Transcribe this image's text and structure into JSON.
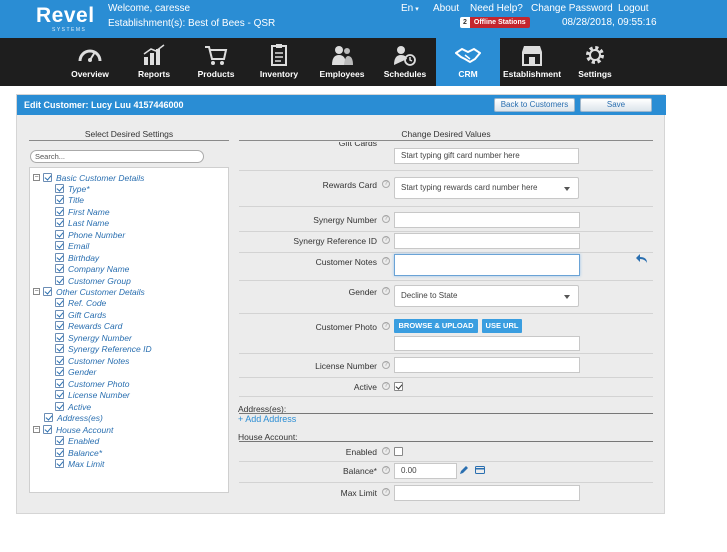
{
  "header": {
    "logo": "Revel",
    "logo_sub": "SYSTEMS",
    "welcome": "Welcome, caresse",
    "establishment": "Establishment(s): Best of Bees - QSR",
    "language": "En",
    "links": {
      "about": "About",
      "help": "Need Help?",
      "change_password": "Change Password",
      "logout": "Logout"
    },
    "offline_count": "2",
    "offline_label": "Offline Stations",
    "datetime": "08/28/2018, 09:55:16"
  },
  "nav": [
    {
      "label": "Overview",
      "icon": "gauge-icon"
    },
    {
      "label": "Reports",
      "icon": "bar-chart-icon"
    },
    {
      "label": "Products",
      "icon": "cart-icon"
    },
    {
      "label": "Inventory",
      "icon": "clipboard-icon"
    },
    {
      "label": "Employees",
      "icon": "people-icon"
    },
    {
      "label": "Schedules",
      "icon": "clock-person-icon"
    },
    {
      "label": "CRM",
      "icon": "handshake-icon"
    },
    {
      "label": "Establishment",
      "icon": "store-icon"
    },
    {
      "label": "Settings",
      "icon": "gear-icon"
    }
  ],
  "panel": {
    "title": "Edit Customer: Lucy Luu 4157446000",
    "back_button": "Back to Customers",
    "save_button": "Save",
    "left_title": "Select Desired Settings",
    "right_title": "Change Desired Values",
    "search_placeholder": "Search..."
  },
  "tree": [
    {
      "label": "Basic Customer Details",
      "level": 0,
      "toggle": "−"
    },
    {
      "label": "Type*",
      "level": 1
    },
    {
      "label": "Title",
      "level": 1
    },
    {
      "label": "First Name",
      "level": 1
    },
    {
      "label": "Last Name",
      "level": 1
    },
    {
      "label": "Phone Number",
      "level": 1
    },
    {
      "label": "Email",
      "level": 1
    },
    {
      "label": "Birthday",
      "level": 1
    },
    {
      "label": "Company Name",
      "level": 1
    },
    {
      "label": "Customer Group",
      "level": 1
    },
    {
      "label": "Other Customer Details",
      "level": 0,
      "toggle": "−"
    },
    {
      "label": "Ref. Code",
      "level": 1
    },
    {
      "label": "Gift Cards",
      "level": 1
    },
    {
      "label": "Rewards Card",
      "level": 1
    },
    {
      "label": "Synergy Number",
      "level": 1
    },
    {
      "label": "Synergy Reference ID",
      "level": 1
    },
    {
      "label": "Customer Notes",
      "level": 1
    },
    {
      "label": "Gender",
      "level": 1
    },
    {
      "label": "Customer Photo",
      "level": 1
    },
    {
      "label": "License Number",
      "level": 1
    },
    {
      "label": "Active",
      "level": 1
    },
    {
      "label": "Address(es)",
      "level": 0.5
    },
    {
      "label": "House Account",
      "level": 0,
      "toggle": "−"
    },
    {
      "label": "Enabled",
      "level": 1
    },
    {
      "label": "Balance*",
      "level": 1
    },
    {
      "label": "Max Limit",
      "level": 1
    }
  ],
  "form": {
    "gift_cards_label": "Gift Cards",
    "gift_cards_placeholder": "Start typing gift card number here",
    "rewards_label": "Rewards Card",
    "rewards_placeholder": "Start typing rewards card number here",
    "synergy_number_label": "Synergy Number",
    "synergy_ref_label": "Synergy Reference ID",
    "notes_label": "Customer Notes",
    "gender_label": "Gender",
    "gender_value": "Decline to State",
    "photo_label": "Customer Photo",
    "browse_button": "BROWSE & UPLOAD",
    "url_button": "USE URL",
    "license_label": "License Number",
    "active_label": "Active",
    "addresses_section": "Address(es):",
    "add_address": "+ Add Address",
    "house_section": "House Account:",
    "enabled_label": "Enabled",
    "balance_label": "Balance*",
    "balance_value": "0.00",
    "max_limit_label": "Max Limit",
    "help_glyph": "?"
  }
}
